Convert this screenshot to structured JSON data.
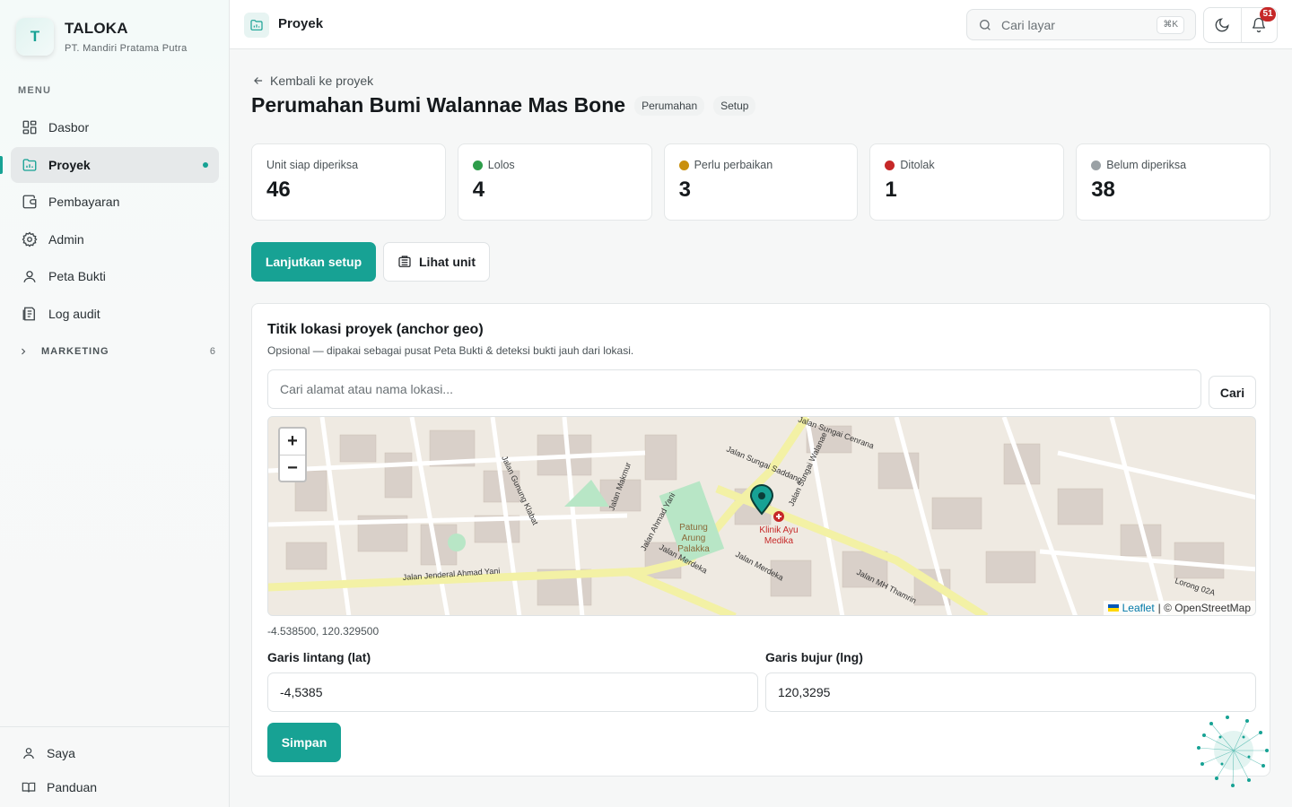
{
  "sidebar": {
    "brand": {
      "logo_letter": "T",
      "name": "TALOKA",
      "company": "PT. Mandiri Pratama Putra"
    },
    "menu_label": "MENU",
    "items": [
      {
        "label": "Dasbor",
        "icon": "dashboard-icon",
        "active": false
      },
      {
        "label": "Proyek",
        "icon": "folder-chart-icon",
        "active": true
      },
      {
        "label": "Pembayaran",
        "icon": "wallet-icon",
        "active": false
      },
      {
        "label": "Admin",
        "icon": "gear-icon",
        "active": false
      },
      {
        "label": "Peta Bukti",
        "icon": "map-pin-user-icon",
        "active": false
      },
      {
        "label": "Log audit",
        "icon": "log-icon",
        "active": false
      }
    ],
    "group": {
      "label": "MARKETING",
      "count": "6"
    },
    "bottom": [
      {
        "label": "Saya",
        "icon": "user-icon"
      },
      {
        "label": "Panduan",
        "icon": "book-icon"
      }
    ]
  },
  "topbar": {
    "title": "Proyek",
    "search_placeholder": "Cari layar",
    "search_shortcut": "⌘K",
    "notification_count": "51"
  },
  "main": {
    "back_label": "Kembali ke proyek",
    "title": "Perumahan Bumi Walannae Mas Bone",
    "tags": [
      "Perumahan",
      "Setup"
    ],
    "stats": [
      {
        "label": "Unit siap diperiksa",
        "value": "46",
        "dot": ""
      },
      {
        "label": "Lolos",
        "value": "4",
        "dot": "#2e9d4a"
      },
      {
        "label": "Perlu perbaikan",
        "value": "3",
        "dot": "#c9900e"
      },
      {
        "label": "Ditolak",
        "value": "1",
        "dot": "#c62828"
      },
      {
        "label": "Belum diperiksa",
        "value": "38",
        "dot": "#9aa1a5"
      }
    ],
    "primary_button": "Lanjutkan setup",
    "secondary_button": "Lihat unit",
    "geo": {
      "title": "Titik lokasi proyek (anchor geo)",
      "description": "Opsional — dipakai sebagai pusat Peta Bukti & deteksi bukti jauh dari lokasi.",
      "search_placeholder": "Cari alamat atau nama lokasi...",
      "search_button": "Cari",
      "map": {
        "zoom_in": "+",
        "zoom_out": "−",
        "attribution_leaflet": "Leaflet",
        "attribution_osm": "| © OpenStreetMap",
        "labels": {
          "road1": "Jalan Jenderal Ahmad Yani",
          "road2": "Jalan Ahmad Yani",
          "road3": "Jalan MH Thamrin",
          "road4": "Jalan Merdeka",
          "road5": "Jalan Sungai Saddang",
          "road6": "Jalan Gunung Klabat",
          "road7": "Jalan Makmur",
          "road8": "Jalan Sungai Walanae",
          "road9": "Jalan Sungai Cenrana",
          "road10": "Lorong 02A",
          "road11": "Jalan Merdeka",
          "poi1": "Patung",
          "poi1b": "Arung",
          "poi1c": "Palakka",
          "poi2": "Klinik Ayu",
          "poi2b": "Medika"
        }
      },
      "coordinates_text": "-4.538500, 120.329500",
      "lat_label": "Garis lintang (lat)",
      "lat_value": "-4,5385",
      "lng_label": "Garis bujur (lng)",
      "lng_value": "120,3295",
      "save_button": "Simpan"
    }
  },
  "colors": {
    "accent": "#17a294",
    "danger": "#c62828"
  }
}
